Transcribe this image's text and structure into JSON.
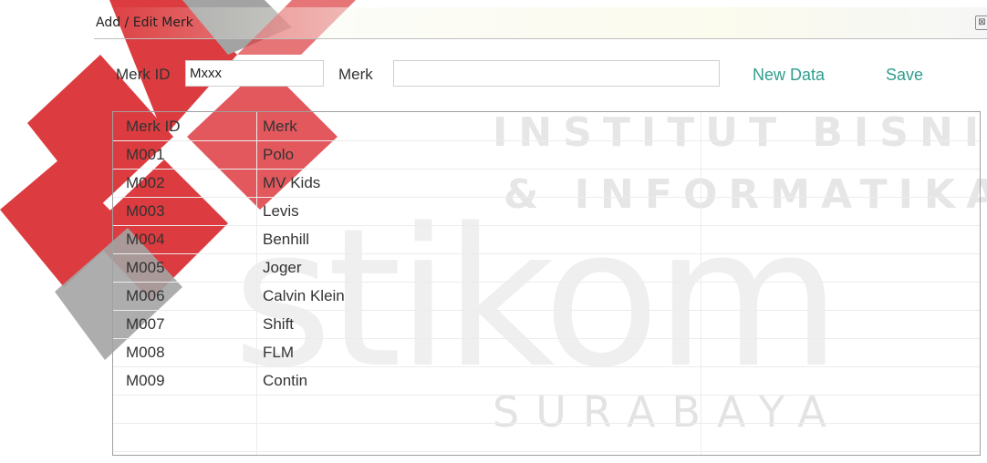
{
  "window": {
    "title": "Add / Edit Merk",
    "close_glyph": "⊠"
  },
  "form": {
    "merk_id_label": "Merk ID",
    "merk_id_value": "Mxxx",
    "merk_label": "Merk",
    "merk_value": "",
    "new_data_label": "New Data",
    "save_label": "Save"
  },
  "grid": {
    "headers": [
      "Merk ID",
      "Merk"
    ],
    "rows": [
      [
        "M001",
        "Polo"
      ],
      [
        "M002",
        "MV Kids"
      ],
      [
        "M003",
        "Levis"
      ],
      [
        "M004",
        "Benhill"
      ],
      [
        "M005",
        "Joger"
      ],
      [
        "M006",
        "Calvin Klein"
      ],
      [
        "M007",
        "Shift"
      ],
      [
        "M008",
        "FLM"
      ],
      [
        "M009",
        "Contin"
      ]
    ]
  },
  "watermark": {
    "line1": "INSTITUT BISNIS",
    "line2": "& INFORMATIKA",
    "line3": "stikom",
    "line4": "SURABAYA",
    "color_red": "#d9262b",
    "color_gray": "#9a9a9a"
  }
}
